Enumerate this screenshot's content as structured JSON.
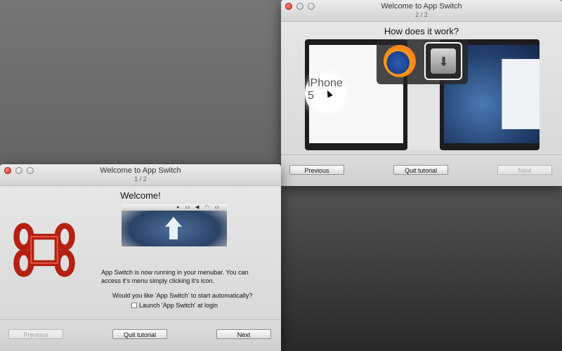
{
  "window_top": {
    "title": "Welcome to App Switch",
    "page": "2 / 2",
    "heading": "How does it work?",
    "illustration": {
      "magnified_text": "iPhone 5",
      "left_app_icon": "firefox-icon",
      "selected_app_icon": "installer-icon"
    },
    "buttons": {
      "previous": "Previous",
      "quit": "Quit tutorial",
      "next": "Next"
    }
  },
  "window_bottom": {
    "title": "Welcome to App Switch",
    "page": "1 / 2",
    "heading": "Welcome!",
    "body_line1": "App Switch is now running in your menubar. You can",
    "body_line2": "access it's menu simply clicking it's icon.",
    "question": "Would you like 'App Switch' to start automatically?",
    "checkbox_label": "Launch 'App Switch' at login",
    "checkbox_checked": false,
    "buttons": {
      "previous": "Previous",
      "quit": "Quit tutorial",
      "next": "Next"
    }
  },
  "colors": {
    "close_button": "#d0281c",
    "logo": "#b42012"
  }
}
